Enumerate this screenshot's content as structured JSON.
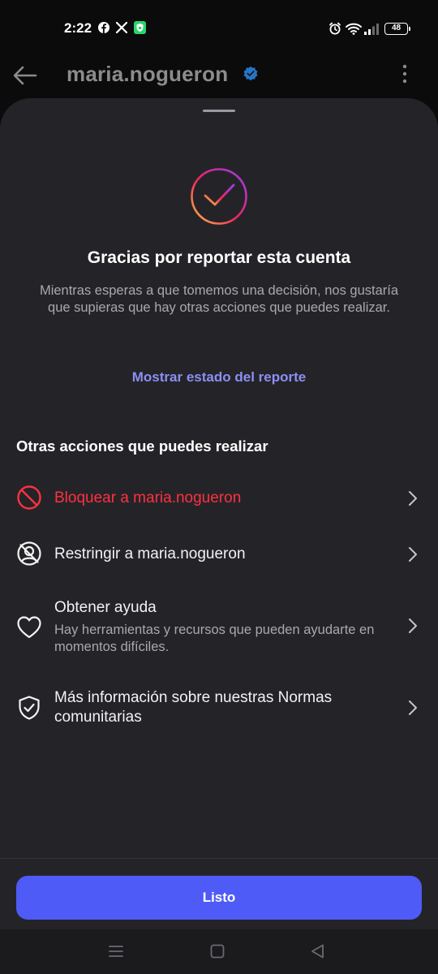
{
  "status_bar": {
    "time": "2:22",
    "battery": "48",
    "left_icons": [
      "facebook-icon",
      "x-icon",
      "vpn-shield-icon"
    ],
    "right_icons": [
      "alarm-icon",
      "wifi-icon",
      "signal-icon",
      "battery-icon"
    ]
  },
  "header": {
    "username": "maria.nogueron",
    "verified": true
  },
  "sheet": {
    "title": "Gracias por reportar esta cuenta",
    "subtitle": "Mientras esperas a que tomemos una decisión, nos gustaría que supieras que hay otras acciones que puedes realizar.",
    "status_link": "Mostrar estado del reporte",
    "section_title": "Otras acciones que puedes realizar",
    "actions": [
      {
        "label": "Bloquear a maria.nogueron",
        "icon": "block-icon",
        "color": "#ff3040"
      },
      {
        "label": "Restringir a maria.nogueron",
        "icon": "restrict-icon"
      },
      {
        "label": "Obtener ayuda",
        "description": "Hay herramientas y recursos que pueden ayudarte en momentos difíciles.",
        "icon": "heart-icon"
      },
      {
        "label": "Más información sobre nuestras Normas comunitarias",
        "icon": "shield-check-icon"
      }
    ],
    "done_button": "Listo"
  },
  "colors": {
    "sheet_bg": "#242428",
    "accent": "#4f5bf7",
    "link": "#8b8ff4",
    "danger": "#ff3040"
  },
  "nav_bar": [
    "menu-icon",
    "home-square-icon",
    "back-triangle-icon"
  ]
}
